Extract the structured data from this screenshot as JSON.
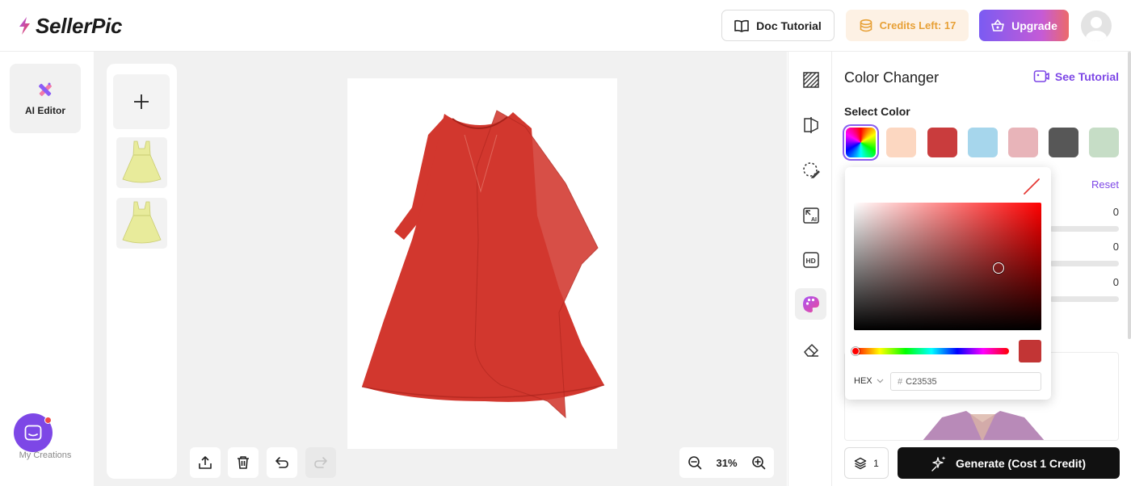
{
  "header": {
    "brand": "SellerPic",
    "doc_tutorial": "Doc Tutorial",
    "credits": "Credits Left: 17",
    "upgrade": "Upgrade"
  },
  "rail": {
    "ai_editor": "AI Editor",
    "my_creations": "My Creations"
  },
  "canvas": {
    "zoom": "31%",
    "garment_color": "#d2372e",
    "thumbnails": [
      "yellow-dress-1",
      "yellow-dress-2"
    ]
  },
  "tools": [
    "stripes-icon",
    "compare-icon",
    "lasso-edit-icon",
    "ai-expand-icon",
    "hd-icon",
    "palette-icon",
    "eraser-icon"
  ],
  "panel": {
    "title": "Color Changer",
    "see_tutorial": "See Tutorial",
    "select_color": "Select Color",
    "swatches": [
      "rainbow",
      "#fcd7c1",
      "#c93c3d",
      "#a6d6ec",
      "#e8b4b9",
      "#575757",
      "#c6ddc6"
    ],
    "reset": "Reset",
    "slider_values": [
      "0",
      "0",
      "0"
    ],
    "layers_count": "1",
    "generate": "Generate (Cost 1 Credit)"
  },
  "picker": {
    "format": "HEX",
    "hash": "#",
    "hex_value": "C23535",
    "current_color": "#c23535"
  }
}
